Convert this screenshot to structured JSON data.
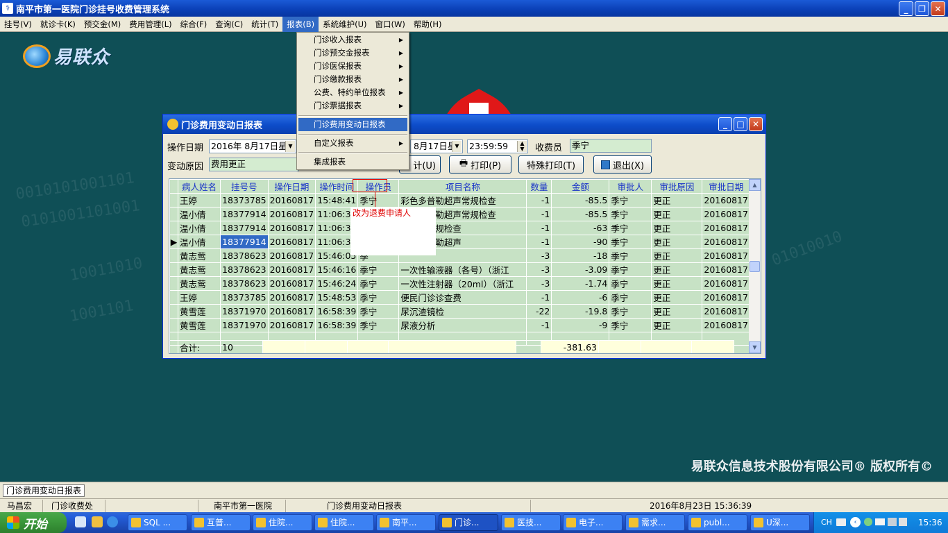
{
  "app": {
    "title": "南平市第一医院门诊挂号收费管理系统"
  },
  "menu": [
    "挂号(V)",
    "就诊卡(K)",
    "预交金(M)",
    "费用管理(L)",
    "综合(F)",
    "查询(C)",
    "统计(T)",
    "报表(B)",
    "系统维护(U)",
    "窗口(W)",
    "帮助(H)"
  ],
  "dropdown": {
    "items": [
      "门诊收入报表",
      "门诊预交金报表",
      "门诊医保报表",
      "门诊缴款报表",
      "公费、特约单位报表",
      "门诊票据报表"
    ],
    "selected": "门诊费用变动日报表",
    "custom": "自定义报表",
    "integrated": "集成报表"
  },
  "desktop": {
    "logo_text": "易联众",
    "copyright": "易联众信息技术股份有限公司® 版权所有©"
  },
  "child": {
    "title": "门诊费用变动日报表",
    "op_date_label": "操作日期",
    "op_date_start": "2016年 8月17日星",
    "op_date_end": "8月17日星",
    "op_time_end": "23:59:59",
    "cashier_label": "收费员",
    "cashier_value": "季宁",
    "reason_label": "变动原因",
    "reason_value": "费用更正",
    "stat_btn": "计(U)",
    "print_btn": "打印(P)",
    "special_print_btn": "特殊打印(T)",
    "exit_btn": "退出(X)"
  },
  "table": {
    "headers": [
      "病人姓名",
      "挂号号",
      "操作日期",
      "操作时间",
      "操作员",
      "项目名称",
      "数量",
      "金额",
      "审批人",
      "审批原因",
      "审批日期"
    ],
    "rows": [
      [
        "王婷",
        "18373785",
        "20160817",
        "15:48:41",
        "季宁",
        "彩色多普勒超声常规检查",
        "-1",
        "-85.5",
        "季宁",
        "更正",
        "20160817"
      ],
      [
        "温小倩",
        "18377914",
        "20160817",
        "11:06:30",
        "季",
        "彩色多普勒超声常规检查",
        "-1",
        "-85.5",
        "季宁",
        "更正",
        "20160817"
      ],
      [
        "温小倩",
        "18377914",
        "20160817",
        "11:06:30",
        "季",
        "勒超声常规检查",
        "-1",
        "-63",
        "季宁",
        "更正",
        "20160817"
      ],
      [
        "温小倩",
        "18377914",
        "20160817",
        "11:06:30",
        "季",
        "彩色多普勒超声",
        "-1",
        "-90",
        "季宁",
        "更正",
        "20160817"
      ],
      [
        "黄志莺",
        "18378623",
        "20160817",
        "15:46:05",
        "季",
        "",
        "-3",
        "-18",
        "季宁",
        "更正",
        "20160817"
      ],
      [
        "黄志莺",
        "18378623",
        "20160817",
        "15:46:16",
        "季宁",
        "一次性输液器（各号）（浙江",
        "-3",
        "-3.09",
        "季宁",
        "更正",
        "20160817"
      ],
      [
        "黄志莺",
        "18378623",
        "20160817",
        "15:46:24",
        "季宁",
        "一次性注射器（20ml）（浙江",
        "-3",
        "-1.74",
        "季宁",
        "更正",
        "20160817"
      ],
      [
        "王婷",
        "18373785",
        "20160817",
        "15:48:53",
        "季宁",
        "便民门诊诊查费",
        "-1",
        "-6",
        "季宁",
        "更正",
        "20160817"
      ],
      [
        "黄雪莲",
        "18371970",
        "20160817",
        "16:58:39",
        "季宁",
        "尿沉渣镜检",
        "-22",
        "-19.8",
        "季宁",
        "更正",
        "20160817"
      ],
      [
        "黄雪莲",
        "18371970",
        "20160817",
        "16:58:39",
        "季宁",
        "尿液分析",
        "-1",
        "-9",
        "季宁",
        "更正",
        "20160817"
      ]
    ],
    "selected_row": 3,
    "summary_label": "合计:",
    "summary_count": "10",
    "summary_amount": "-381.63"
  },
  "annotation": {
    "text": "改为退费申请人",
    "color": "#e00000"
  },
  "mdi": {
    "tab": "门诊费用变动日报表"
  },
  "status": {
    "user": "马昌宏",
    "dept": "门诊收费处",
    "hospital": "南平市第一医院",
    "form": "门诊费用变动日报表",
    "datetime": "2016年8月23日 15:36:39"
  },
  "taskbar": {
    "start": "开始",
    "tasks": [
      "SQL ...",
      "互普...",
      "住院...",
      "住院...",
      "南平...",
      "门诊...",
      "医技...",
      "电子...",
      "需求...",
      "publ...",
      "U深..."
    ],
    "lang": "CH",
    "clock": "15:36"
  }
}
